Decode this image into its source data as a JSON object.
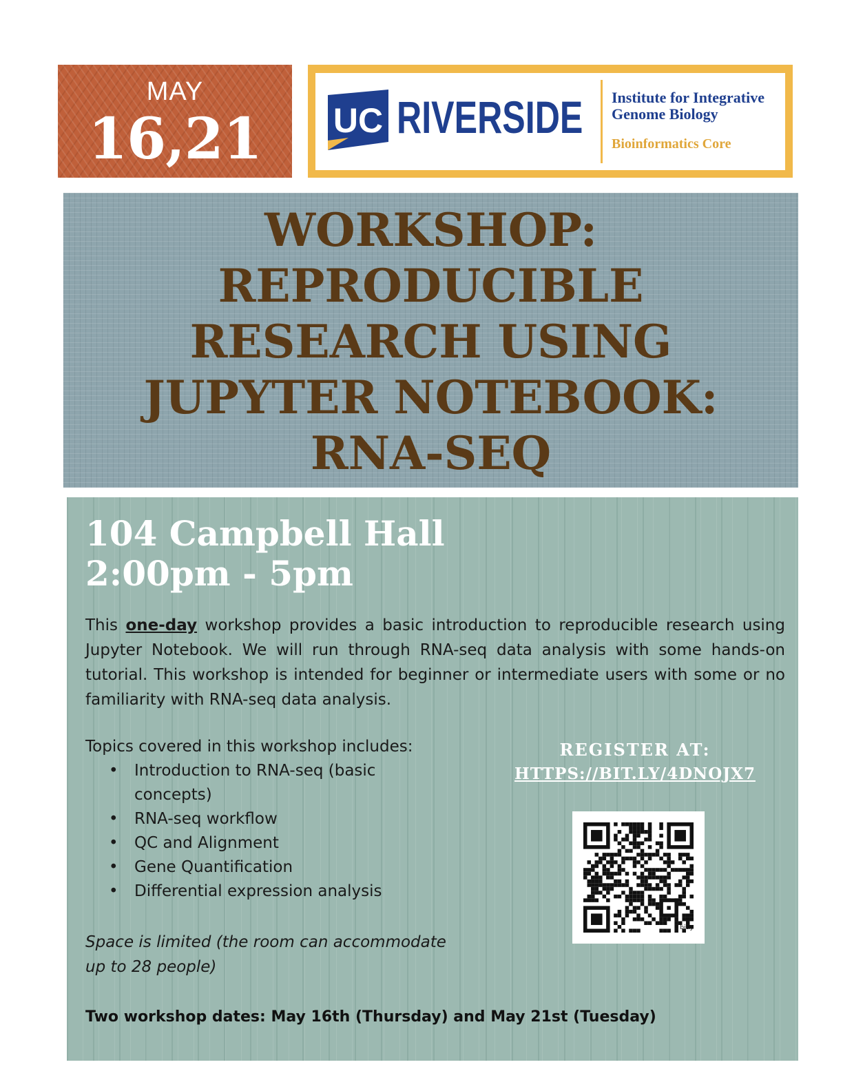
{
  "date": {
    "month": "MAY",
    "days": "16,21"
  },
  "logo": {
    "uc_mark": "UC",
    "campus": "RIVERSIDE",
    "institute": "Institute for Integrative Genome Biology",
    "core": "Bioinformatics Core",
    "colors": {
      "uc_blue": "#1f3f8f",
      "uc_gold": "#f1b94a"
    }
  },
  "title": {
    "lines": [
      "WORKSHOP:",
      "REPRODUCIBLE",
      "RESEARCH USING",
      "JUPYTER NOTEBOOK:",
      "RNA-SEQ"
    ]
  },
  "event": {
    "venue": "104 Campbell Hall",
    "time": "2:00pm - 5pm"
  },
  "description": {
    "before": "This ",
    "emphasis": "one-day",
    "after": " workshop provides a basic introduction to reproducible research using Jupyter Notebook. We will run through RNA-seq data analysis with some hands-on tutorial. This workshop is intended for beginner or intermediate users with some or no familiarity with RNA-seq data analysis."
  },
  "topics": {
    "heading": "Topics covered in this workshop includes:",
    "bullet": "•",
    "items": [
      "Introduction to RNA-seq (basic concepts)",
      "RNA-seq workflow",
      "QC and Alignment",
      "Gene Quantification",
      "Differential expression analysis"
    ]
  },
  "space_note": "Space is limited (the room can accommodate up to 28 people)",
  "dates_note": "Two workshop dates: May 16th (Thursday) and May 21st (Tuesday)",
  "register": {
    "label": "REGISTER AT:",
    "link": "HTTPS://BIT.LY/4DNOJX7",
    "qr_brand": "bitly"
  }
}
